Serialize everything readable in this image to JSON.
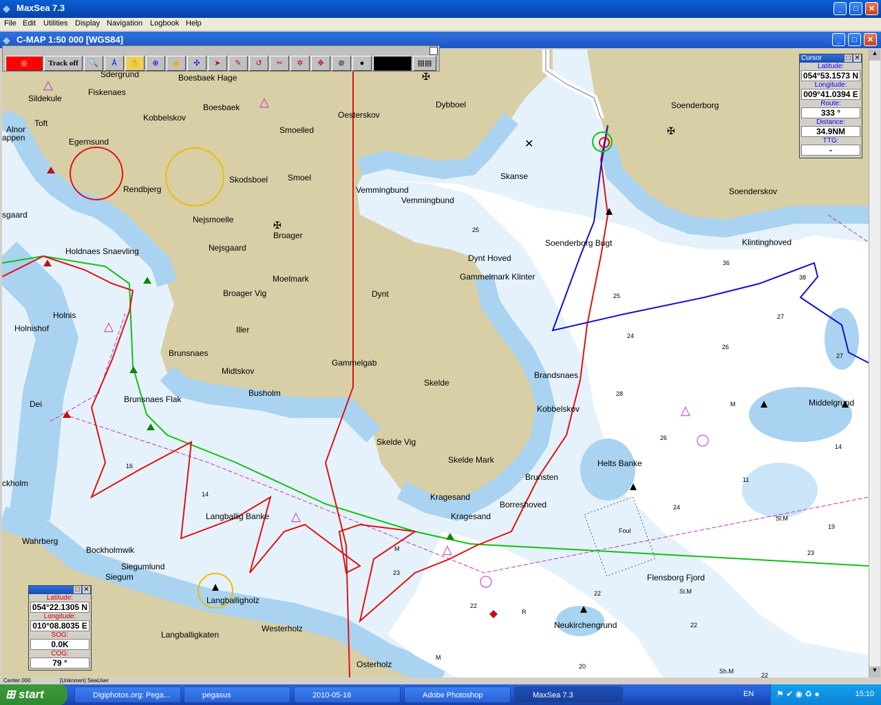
{
  "app": {
    "title": "MaxSea 7.3"
  },
  "menu": [
    "File",
    "Edit",
    "Utilities",
    "Display",
    "Navigation",
    "Logbook",
    "Help"
  ],
  "chart_window": {
    "title": "C-MAP  1:50 000 [WGS84]"
  },
  "toolbar": {
    "track_label": "Track off"
  },
  "cursor_panel": {
    "title": "Cursor",
    "lat_label": "Latitude:",
    "lat": "054°53.1573 N",
    "lon_label": "Longitude:",
    "lon": "009°41.0394 E",
    "route_label": "Route:",
    "route": "333 °",
    "dist_label": "Distance:",
    "dist": "34.9NM",
    "ttg_label": "TTG:",
    "ttg": "-"
  },
  "boat_panel": {
    "lat_label": "Latitude:",
    "lat": "054°22.1305 N",
    "lon_label": "Longitude:",
    "lon": "010°08.8035 E",
    "sog_label": "SOG:",
    "sog": "0.0K",
    "cog_label": "COG:",
    "cog": "79 °"
  },
  "statusbar": {
    "left": "Center 000",
    "middle": "[Unknown] SeaUser"
  },
  "places": [
    {
      "id": "sdergrund",
      "text": "Soenderborg"
    },
    {
      "id": "dybboel",
      "text": "Dybboel"
    },
    {
      "id": "oesterskov",
      "text": "Oesterskov"
    },
    {
      "id": "boesbaek",
      "text": "Boesbaek"
    },
    {
      "id": "boesbaekhage",
      "text": "Boesbaek Hage"
    },
    {
      "id": "kobbelskov1",
      "text": "Kobbelskov"
    },
    {
      "id": "smoelled",
      "text": "Smoelled"
    },
    {
      "id": "smoel",
      "text": "Smoel"
    },
    {
      "id": "skodsboel",
      "text": "Skodsboel"
    },
    {
      "id": "rendbjerg",
      "text": "Rendbjerg"
    },
    {
      "id": "egernsund",
      "text": "Egernsund"
    },
    {
      "id": "fiskenaes",
      "text": "Fiskenaes"
    },
    {
      "id": "sildekule",
      "text": "Sildekule"
    },
    {
      "id": "alnor",
      "text": "Alnor"
    },
    {
      "id": "toft",
      "text": "Toft"
    },
    {
      "id": "nejsmoelle",
      "text": "Nejsmoelle"
    },
    {
      "id": "nejsgaard",
      "text": "Nejsgaard"
    },
    {
      "id": "broager",
      "text": "Broager"
    },
    {
      "id": "moelmark",
      "text": "Moelmark"
    },
    {
      "id": "broagervig",
      "text": "Broager Vig"
    },
    {
      "id": "holdnaes",
      "text": "Holdnaes Snaevling"
    },
    {
      "id": "holnis",
      "text": "Holnis"
    },
    {
      "id": "holnishof",
      "text": "Holnishof"
    },
    {
      "id": "iller",
      "text": "Iller"
    },
    {
      "id": "brunsnaes",
      "text": "Brunsnaes"
    },
    {
      "id": "midtskov",
      "text": "Midtskov"
    },
    {
      "id": "busholm",
      "text": "Busholm"
    },
    {
      "id": "gammelgab",
      "text": "Gammelgab"
    },
    {
      "id": "dynt",
      "text": "Dynt"
    },
    {
      "id": "skelde",
      "text": "Skelde"
    },
    {
      "id": "skeldevig",
      "text": "Skelde Vig"
    },
    {
      "id": "skeldemark",
      "text": "Skelde Mark"
    },
    {
      "id": "kragesand1",
      "text": "Kragesand"
    },
    {
      "id": "kragesand2",
      "text": "Kragesand"
    },
    {
      "id": "brunsnaesflak",
      "text": "Brunsnaes Flak"
    },
    {
      "id": "langballigbanke",
      "text": "Langballig Banke"
    },
    {
      "id": "langballigholz",
      "text": "Langballigholz"
    },
    {
      "id": "westerholz",
      "text": "Westerholz"
    },
    {
      "id": "langballigkaten",
      "text": "Langballigkaten"
    },
    {
      "id": "siegumlund",
      "text": "Siegumlund"
    },
    {
      "id": "siegum",
      "text": "Siegum"
    },
    {
      "id": "bockholmwik",
      "text": "Bockholmwik"
    },
    {
      "id": "wahrberg",
      "text": "Wahrberg"
    },
    {
      "id": "ckholm",
      "text": "ckholm"
    },
    {
      "id": "osterholz",
      "text": "Osterholz"
    },
    {
      "id": "skanse",
      "text": "Skanse"
    },
    {
      "id": "vemmingbund1",
      "text": "Vemmingbund"
    },
    {
      "id": "vemmingbund2",
      "text": "Vemmingbund"
    },
    {
      "id": "dynthoved",
      "text": "Dynt Hoved"
    },
    {
      "id": "gammelmark",
      "text": "Gammelmark Klinter"
    },
    {
      "id": "soenderborgbugt",
      "text": "Soenderborg Bugt"
    },
    {
      "id": "soenderskov",
      "text": "Soenderskov"
    },
    {
      "id": "klintinghoved",
      "text": "Klintinghoved"
    },
    {
      "id": "brandsnaes",
      "text": "Brandsnaes"
    },
    {
      "id": "kobbelskov2",
      "text": "Kobbelskov"
    },
    {
      "id": "brunsten",
      "text": "Brunsten"
    },
    {
      "id": "borreshoved",
      "text": "Borreshoved"
    },
    {
      "id": "helts",
      "text": "Helts Banke"
    },
    {
      "id": "flensborg",
      "text": "Flensborg Fjord"
    },
    {
      "id": "neukirchen",
      "text": "Neukirchengrund"
    },
    {
      "id": "middelgrund",
      "text": "Middelgrund"
    },
    {
      "id": "foul",
      "text": "Foul"
    },
    {
      "id": "dei",
      "text": "Dei"
    },
    {
      "id": "appen",
      "text": "appen"
    },
    {
      "id": "sgaard",
      "text": "sgaard"
    },
    {
      "id": "sildekule2",
      "text": "Sdergrund"
    }
  ],
  "taskbar": {
    "start": "start",
    "tasks": [
      "Digiphotos.org: Pega...",
      "pegasus",
      "2010-05-16",
      "Adobe Photoshop",
      "MaxSea 7.3"
    ],
    "lang": "EN",
    "clock": "15:10"
  },
  "colors": {
    "land": "#d8cfa6",
    "shallow": "#a9d3f0",
    "deep": "#ffffff",
    "mid": "#e6f2fb",
    "track_red": "#e01010",
    "route_green": "#12c012",
    "route_blue": "#1010d0"
  }
}
